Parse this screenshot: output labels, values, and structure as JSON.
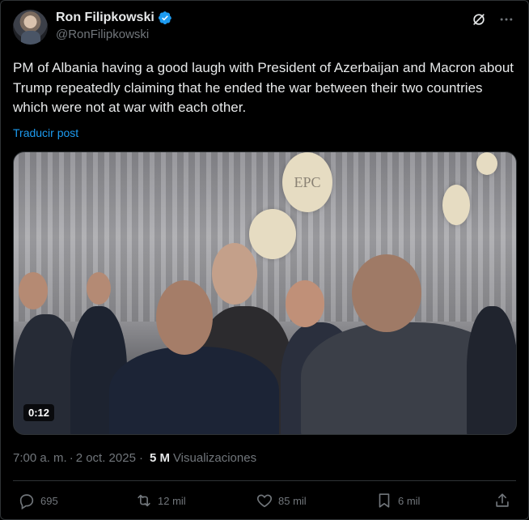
{
  "author": {
    "display_name": "Ron Filipkowski",
    "handle": "@RonFilipkowski",
    "verified_icon": "verified-badge-icon",
    "avatar_icon": "avatar"
  },
  "tweet": {
    "text": "PM of Albania having a good laugh with President of Azerbaijan and Macron about Trump repeatedly claiming that he ended the war between their two countries which were not at war with each other.",
    "translate_label": "Traducir post"
  },
  "media": {
    "duration": "0:12",
    "logo_text": "EPC"
  },
  "meta": {
    "time": "7:00 a. m.",
    "separator": "·",
    "date": "2 oct. 2025",
    "dot": "·",
    "views_count": "5 M",
    "views_label": "Visualizaciones"
  },
  "actions": {
    "replies": "695",
    "reposts": "12 mil",
    "likes": "85 mil",
    "bookmarks": "6 mil"
  },
  "colors": {
    "background": "#000000",
    "text": "#e7e9ea",
    "muted": "#71767b",
    "link": "#1d9bf0",
    "border": "#2f3336"
  }
}
